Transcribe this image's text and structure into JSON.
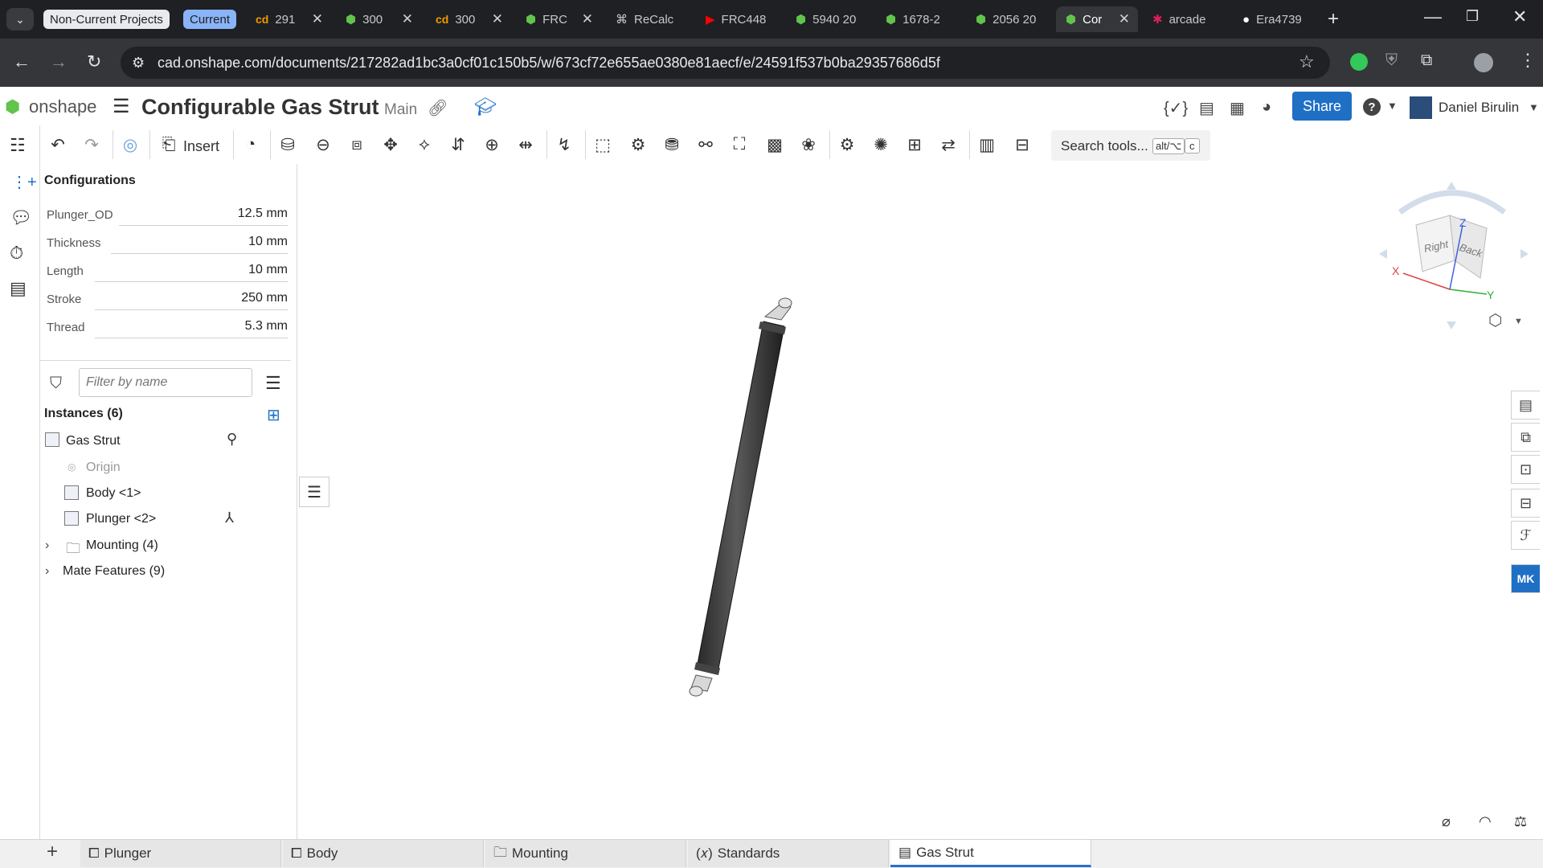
{
  "browser": {
    "tab_groups": [
      {
        "label": "Non-Current Projects",
        "bg": "#e8eaed",
        "fg": "#202124"
      },
      {
        "label": "Current",
        "bg": "#8ab4f8",
        "fg": "#202124"
      }
    ],
    "tabs": [
      {
        "icon": "cd",
        "label": "291"
      },
      {
        "icon": "onshape-icon",
        "label": "300"
      },
      {
        "icon": "cd",
        "label": "300"
      },
      {
        "icon": "onshape-icon",
        "label": "FRC"
      },
      {
        "icon": "recalc-icon",
        "label": "ReCalc"
      },
      {
        "icon": "youtube-icon",
        "label": "FRC448"
      },
      {
        "icon": "onshape-icon",
        "label": "5940 20"
      },
      {
        "icon": "onshape-icon",
        "label": "1678-2"
      },
      {
        "icon": "onshape-icon",
        "label": "2056 20"
      },
      {
        "icon": "onshape-icon",
        "label": "Cor"
      },
      {
        "icon": "slack-icon",
        "label": "arcade"
      },
      {
        "icon": "github-icon",
        "label": "Era4739"
      }
    ],
    "url": "cad.onshape.com/documents/217282ad1bc3a0cf01c150b5/w/673cf72e655ae0380e81aecf/e/24591f537b0ba29357686d5f"
  },
  "app": {
    "logo": "onshape",
    "title": "Configurable Gas Strut",
    "branch": "Main",
    "share_label": "Share",
    "user_name": "Daniel Birulin",
    "accent": "#1f6fc5"
  },
  "toolbar": {
    "insert_label": "Insert",
    "search_label": "Search tools...",
    "shortcut_1": "alt/⌥",
    "shortcut_2": "c"
  },
  "configurations": {
    "heading": "Configurations",
    "rows": [
      {
        "label": "Plunger_OD",
        "value": "12.5 mm"
      },
      {
        "label": "Thickness",
        "value": "10 mm"
      },
      {
        "label": "Length",
        "value": "10 mm"
      },
      {
        "label": "Stroke",
        "value": "250 mm"
      },
      {
        "label": "Thread",
        "value": "5.3 mm"
      }
    ]
  },
  "instances": {
    "filter_placeholder": "Filter by name",
    "heading": "Instances (6)",
    "root": "Gas Strut",
    "origin": "Origin",
    "body": "Body <1>",
    "plunger": "Plunger <2>",
    "mounting": "Mounting (4)",
    "mate_features": "Mate Features (9)"
  },
  "viewcube": {
    "right": "Right",
    "back": "Back",
    "x": "X",
    "y": "Y",
    "z": "Z"
  },
  "bottom_tabs": [
    {
      "label": "Plunger"
    },
    {
      "label": "Body"
    },
    {
      "label": "Mounting"
    },
    {
      "label": "Standards"
    },
    {
      "label": "Gas Strut"
    }
  ]
}
